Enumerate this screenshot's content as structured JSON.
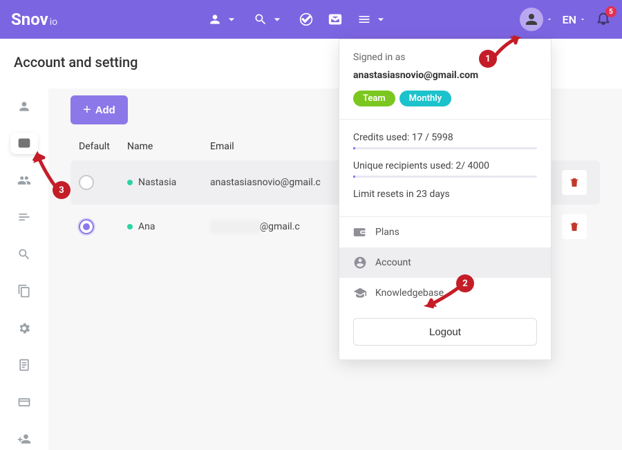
{
  "brand": "Snov",
  "brand_suffix": "io",
  "lang": "EN",
  "notif_count": "5",
  "page_title": "Account and setting",
  "add_button": "Add",
  "columns": {
    "default": "Default",
    "name": "Name",
    "email": "Email"
  },
  "rows": [
    {
      "name": "Nastasia",
      "email": "anastasiasnovio@gmail.c",
      "selected": false
    },
    {
      "name": "Ana",
      "email": "@gmail.c",
      "selected": true,
      "blurred": true
    }
  ],
  "dropdown": {
    "signed_in": "Signed in as",
    "email": "anastasiasnovio@gmail.com",
    "pill_team": "Team",
    "pill_plan": "Monthly",
    "credits_line": "Credits used: 17 / 5998",
    "recipients_line": "Unique recipients used: 2/ 4000",
    "resets_line": "Limit resets in 23 days",
    "menu": {
      "plans": "Plans",
      "account": "Account",
      "kb": "Knowledgebase"
    },
    "logout": "Logout"
  },
  "callouts": {
    "c1": "1",
    "c2": "2",
    "c3": "3"
  }
}
